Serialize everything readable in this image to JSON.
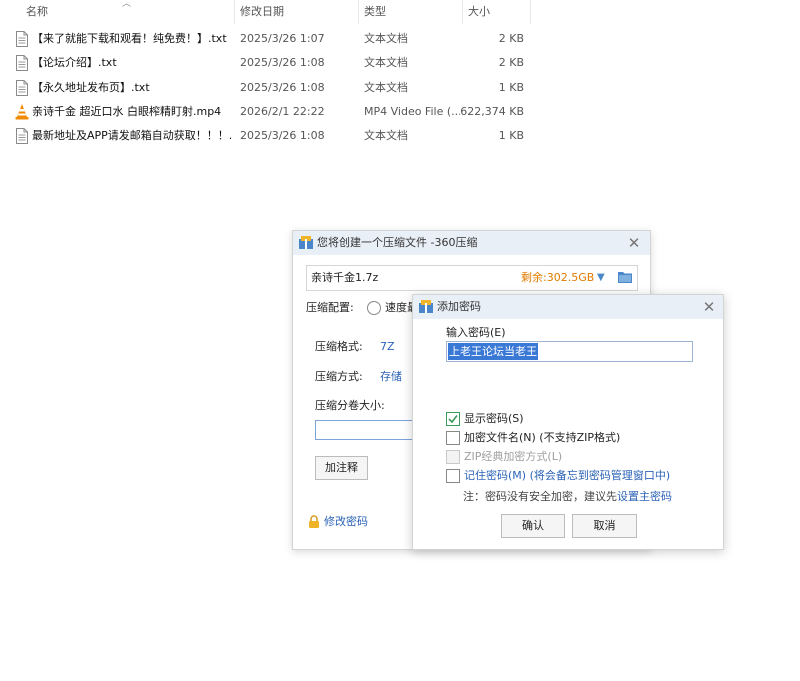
{
  "explorer": {
    "columns": {
      "name": "名称",
      "date": "修改日期",
      "type": "类型",
      "size": "大小"
    },
    "files": [
      {
        "name": "【来了就能下载和观看！纯免费！】.txt",
        "date": "2025/3/26 1:07",
        "type": "文本文档",
        "size": "2 KB",
        "icon": "text-file-icon"
      },
      {
        "name": "【论坛介绍】.txt",
        "date": "2025/3/26 1:08",
        "type": "文本文档",
        "size": "2 KB",
        "icon": "text-file-icon"
      },
      {
        "name": "【永久地址发布页】.txt",
        "date": "2025/3/26 1:08",
        "type": "文本文档",
        "size": "1 KB",
        "icon": "text-file-icon"
      },
      {
        "name": "亲诗千金 超近口水 白眼榨精盯射.mp4",
        "date": "2026/2/1 22:22",
        "type": "MP4 Video File (...",
        "size": "622,374 KB",
        "icon": "vlc-cone-icon"
      },
      {
        "name": "最新地址及APP请发邮箱自动获取！！！....",
        "date": "2025/3/26 1:08",
        "type": "文本文档",
        "size": "1 KB",
        "icon": "text-file-icon"
      }
    ]
  },
  "compress_dialog": {
    "title": "您将创建一个压缩文件 -360压缩",
    "path_value": "亲诗千金1.7z",
    "free_space": "剩余:302.5GB",
    "config_label": "压缩配置:",
    "config_option": "速度最",
    "format_label": "压缩格式:",
    "format_value": "7Z",
    "method_label": "压缩方式:",
    "method_value": "存储",
    "volume_label": "压缩分卷大小:",
    "comment_button": "加注释",
    "change_password_link": "修改密码"
  },
  "password_dialog": {
    "title": "添加密码",
    "input_label": "输入密码(E)",
    "password_value": "上老王论坛当老王",
    "show_password": {
      "label": "显示密码(S)",
      "checked": true
    },
    "encrypt_names": {
      "label": "加密文件名(N) (不支持ZIP格式)",
      "checked": false
    },
    "zip_classic": {
      "label": "ZIP经典加密方式(L)",
      "checked": false,
      "disabled": true
    },
    "remember": {
      "label": "记住密码(M) (将会备忘到密码管理窗口中)",
      "checked": false
    },
    "note_text": "注：密码没有安全加密，建议先",
    "note_link": "设置主密码",
    "ok_button": "确认",
    "cancel_button": "取消"
  },
  "colors": {
    "accent": "#2b63b6",
    "title_bar": "#e9eff7",
    "warning": "#e07b00",
    "selection": "#3a78d6"
  }
}
